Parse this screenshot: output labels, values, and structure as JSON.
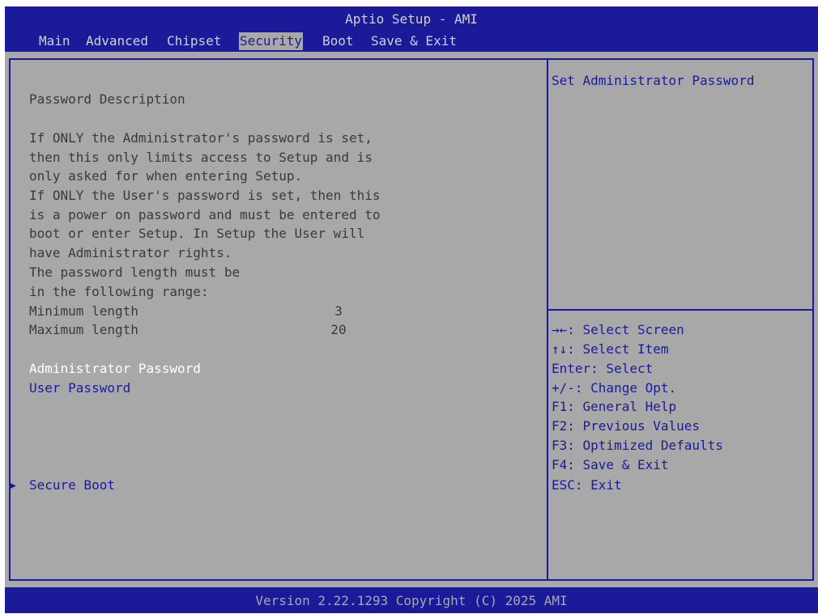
{
  "header": {
    "title": "Aptio Setup - AMI",
    "tabs": [
      "Main",
      "Advanced",
      "Chipset",
      "Security",
      "Boot",
      "Save & Exit"
    ],
    "active_tab": "Security"
  },
  "main": {
    "description_lines": [
      "Password Description",
      "If ONLY the Administrator's password is set,",
      "then this only limits access to Setup and is",
      "only asked for when entering Setup.",
      "If ONLY the User's password is set, then this",
      "is a power on password and must be entered to",
      "boot or enter Setup. In Setup the User will",
      "have Administrator rights.",
      "The password length must be",
      "in the following range:"
    ],
    "min_length_label": "Minimum length",
    "min_length_value": "3",
    "max_length_label": "Maximum length",
    "max_length_value": "20",
    "menu_items": [
      "Administrator Password",
      "User Password"
    ],
    "selected_item": "Administrator Password",
    "submenu_arrow": "▶",
    "submenu_label": "Secure Boot"
  },
  "help": {
    "text": "Set Administrator Password",
    "keys": [
      "→←: Select Screen",
      "↑↓: Select Item",
      "Enter: Select",
      "+/-: Change Opt.",
      "F1: General Help",
      "F2: Previous Values",
      "F3: Optimized Defaults",
      "F4: Save & Exit",
      "ESC: Exit"
    ]
  },
  "footer": {
    "text": "Version 2.22.1293 Copyright (C) 2025 AMI"
  },
  "colors": {
    "bios_blue": "#1b1b9a",
    "background_gray": "#a8a8a8",
    "text_dark": "#3a3a3a",
    "selected_white": "#ffffff"
  }
}
